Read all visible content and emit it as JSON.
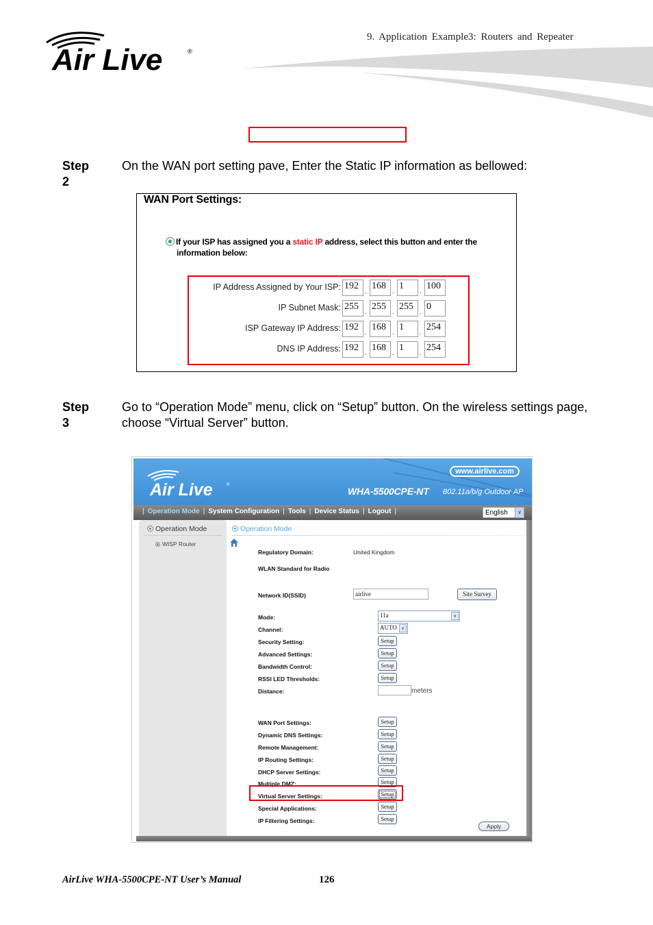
{
  "header": {
    "brand": "Air Live",
    "chapter_title": "9. Application Example3: Routers and Repeater"
  },
  "steps": [
    {
      "label": "Step 2",
      "text": "On the WAN port setting pave, Enter the Static IP information as bellowed:"
    },
    {
      "label": "Step 3",
      "text": "Go to “Operation Mode” menu, click on “Setup” button.   On the wireless settings page, choose “Virtual Server” button."
    }
  ],
  "wan_settings": {
    "title": "WAN Port Settings:",
    "radio_text_before": "If your ISP has assigned you a ",
    "radio_text_highlight": "static IP",
    "radio_text_after": " address, select this button and enter the",
    "radio_text_line2": "information below:",
    "radio_selected": true,
    "rows": [
      {
        "label": "IP Address Assigned by Your ISP:",
        "octets": [
          "192",
          "168",
          "1",
          "100"
        ]
      },
      {
        "label": "IP Subnet Mask:",
        "octets": [
          "255",
          "255",
          "255",
          "0"
        ]
      },
      {
        "label": "ISP Gateway IP Address:",
        "octets": [
          "192",
          "168",
          "1",
          "254"
        ]
      },
      {
        "label": "DNS IP Address:",
        "octets": [
          "192",
          "168",
          "1",
          "254"
        ]
      }
    ]
  },
  "router_ui": {
    "brand": "Air Live",
    "url": "www.airlive.com",
    "model": "WHA-5500CPE-NT",
    "model_desc": "802.11a/b/g Outdoor AP",
    "nav": [
      {
        "label": "Operation Mode",
        "active": true
      },
      {
        "label": "System Configuration",
        "active": false
      },
      {
        "label": "Tools",
        "active": false
      },
      {
        "label": "Device Status",
        "active": false
      },
      {
        "label": "Logout",
        "active": false
      }
    ],
    "language": "English",
    "sidebar": {
      "title": "Operation Mode",
      "sub_item": "WISP Router"
    },
    "main_title": "Operation Mode",
    "fields": {
      "regulatory_domain": {
        "label": "Regulatory Domain:",
        "value": "United Kingdom"
      },
      "wlan_standard": {
        "label": "WLAN Standard for Radio"
      },
      "ssid": {
        "label": "Network ID(SSID)",
        "value": "airlive",
        "button": "Site Survey"
      },
      "mode": {
        "label": "Mode:",
        "value": "11a"
      },
      "channel": {
        "label": "Channel:",
        "value": "AUTO"
      },
      "distance": {
        "label": "Distance:",
        "value": "",
        "unit": "meters"
      }
    },
    "setup_label": "Setup",
    "setup_rows_group1": [
      "Security Setting:",
      "Advanced Settings:",
      "Bandwidth Control:",
      "RSSI LED Thresholds:"
    ],
    "setup_rows_group2": [
      "WAN Port Settings:",
      "Dynamic DNS Settings:",
      "Remote Management:",
      "IP Routing Settings:",
      "DHCP Server Settings:",
      "Multiple DMZ:",
      "Virtual Server Settings:",
      "Special Applications:",
      "IP Filtering Settings:"
    ],
    "highlighted_row": "Virtual Server Settings:",
    "apply_label": "Apply"
  },
  "footer": {
    "manual_title": "AirLive WHA-5500CPE-NT User’s Manual",
    "page_number": "126"
  }
}
